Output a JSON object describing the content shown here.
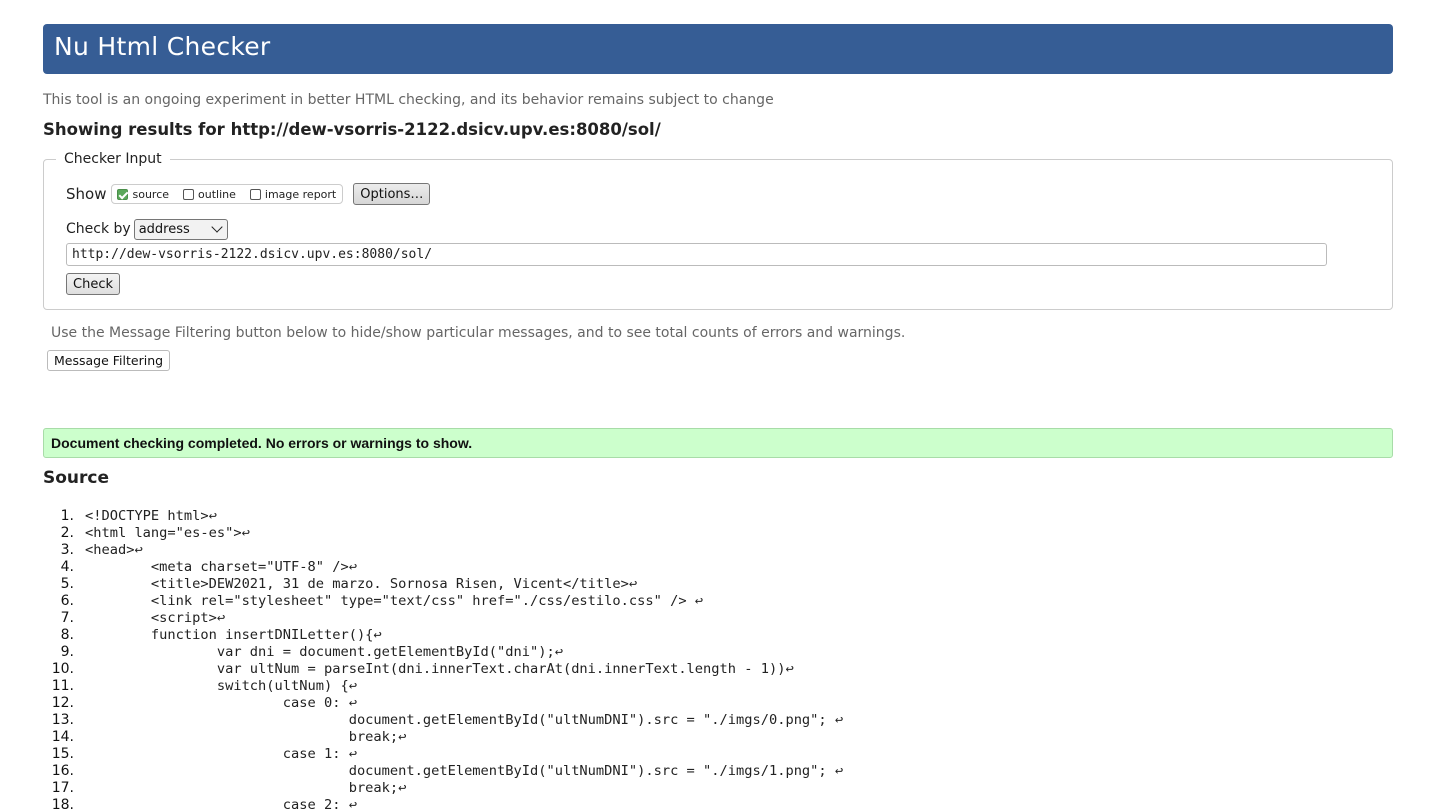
{
  "header": {
    "title": "Nu Html Checker",
    "subtitle": "This tool is an ongoing experiment in better HTML checking, and its behavior remains subject to change",
    "results_for": "Showing results for http://dew-vsorris-2122.dsicv.upv.es:8080/sol/"
  },
  "checker_input": {
    "legend": "Checker Input",
    "show_label": "Show",
    "options": [
      {
        "label": "source",
        "checked": true
      },
      {
        "label": "outline",
        "checked": false
      },
      {
        "label": "image report",
        "checked": false
      }
    ],
    "options_button": "Options…",
    "check_by_label": "Check by",
    "check_by_value": "address",
    "url_value": "http://dew-vsorris-2122.dsicv.upv.es:8080/sol/",
    "check_button": "Check"
  },
  "filtering": {
    "note": "Use the Message Filtering button below to hide/show particular messages, and to see total counts of errors and warnings.",
    "button": "Message Filtering"
  },
  "status": {
    "message": "Document checking completed. No errors or warnings to show.",
    "color": "#ccffcc"
  },
  "source": {
    "heading": "Source",
    "lines": [
      {
        "n": "1.",
        "text": "<!DOCTYPE html>↩"
      },
      {
        "n": "2.",
        "text": "<html lang=\"es-es\">↩"
      },
      {
        "n": "3.",
        "text": "<head>↩"
      },
      {
        "n": "4.",
        "text": "        <meta charset=\"UTF-8\" />↩"
      },
      {
        "n": "5.",
        "text": "        <title>DEW2021, 31 de marzo. Sornosa Risen, Vicent</title>↩"
      },
      {
        "n": "6.",
        "text": "        <link rel=\"stylesheet\" type=\"text/css\" href=\"./css/estilo.css\" /> ↩"
      },
      {
        "n": "7.",
        "text": "        <script>↩"
      },
      {
        "n": "8.",
        "text": "        function insertDNILetter(){↩"
      },
      {
        "n": "9.",
        "text": "                var dni = document.getElementById(\"dni\");↩"
      },
      {
        "n": "10.",
        "text": "                var ultNum = parseInt(dni.innerText.charAt(dni.innerText.length - 1))↩"
      },
      {
        "n": "11.",
        "text": "                switch(ultNum) {↩"
      },
      {
        "n": "12.",
        "text": "                        case 0: ↩"
      },
      {
        "n": "13.",
        "text": "                                document.getElementById(\"ultNumDNI\").src = \"./imgs/0.png\"; ↩"
      },
      {
        "n": "14.",
        "text": "                                break;↩"
      },
      {
        "n": "15.",
        "text": "                        case 1: ↩"
      },
      {
        "n": "16.",
        "text": "                                document.getElementById(\"ultNumDNI\").src = \"./imgs/1.png\"; ↩"
      },
      {
        "n": "17.",
        "text": "                                break;↩"
      },
      {
        "n": "18.",
        "text": "                        case 2: ↩"
      }
    ]
  },
  "colors": {
    "banner": "#365d95",
    "success": "#ccffcc",
    "checkbox_checked": "#5aa85a"
  }
}
